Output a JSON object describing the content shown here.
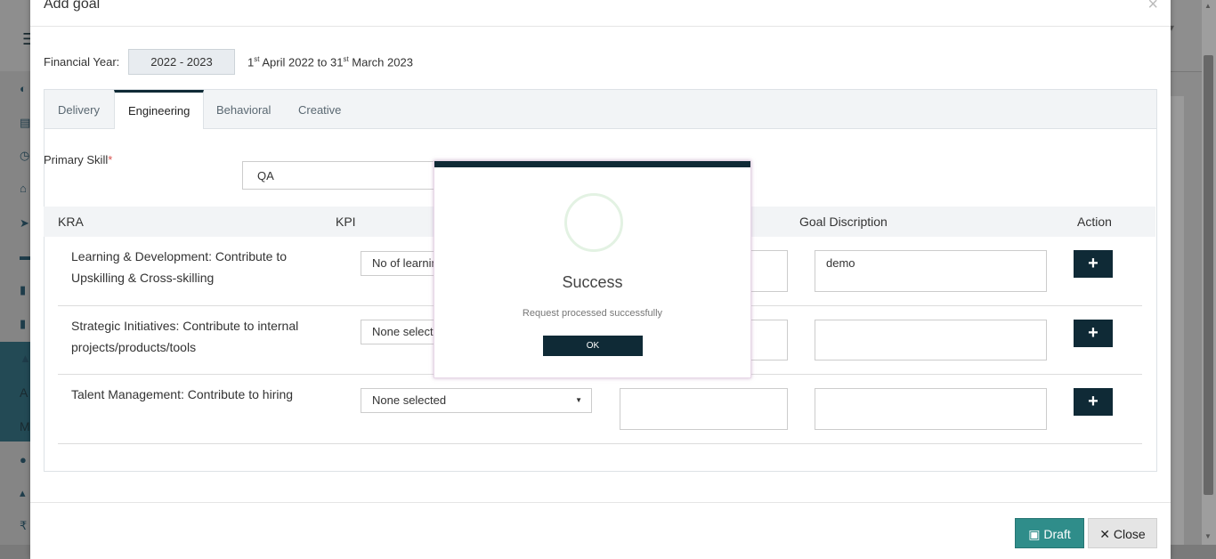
{
  "modal": {
    "title": "Add goal",
    "close_icon": "×",
    "financial_year_label": "Financial Year:",
    "financial_year_value": "2022 - 2023",
    "fy_range": {
      "part1": "1",
      "sup1": "st",
      "part2": " April 2022 to 31",
      "sup2": "st",
      "part3": " March 2023"
    },
    "tabs": [
      {
        "label": "Delivery"
      },
      {
        "label": "Engineering"
      },
      {
        "label": "Behavioral"
      },
      {
        "label": "Creative"
      }
    ],
    "active_tab": "Engineering",
    "primary_skill_label": "Primary Skill",
    "required_mark": "*",
    "primary_skill_value": "QA",
    "table_headers": {
      "kra": "KRA",
      "kpi": "KPI",
      "goal_description": "Goal Discription",
      "action": "Action"
    },
    "rows": [
      {
        "kra": "Learning & Development: Contribute to Upskilling & Cross-skilling",
        "kpi": "No of learnin",
        "target": "",
        "goal_description": "demo"
      },
      {
        "kra": "Strategic Initiatives: Contribute to internal projects/products/tools",
        "kpi": "None selecte",
        "target": "",
        "goal_description": ""
      },
      {
        "kra": "Talent Management: Contribute to hiring",
        "kpi": "None selected",
        "target": "",
        "goal_description": ""
      }
    ],
    "plus_label": "+",
    "draft_label": "Draft",
    "close_label": "Close"
  },
  "dialog": {
    "title": "Success",
    "message": "Request processed successfully",
    "ok_label": "OK"
  },
  "background": {
    "menu_text_1": "A",
    "menu_text_2": "M",
    "rupee": "₹"
  },
  "colors": {
    "primary_dark": "#0f2a36",
    "draft_teal": "#2f8d8a"
  }
}
